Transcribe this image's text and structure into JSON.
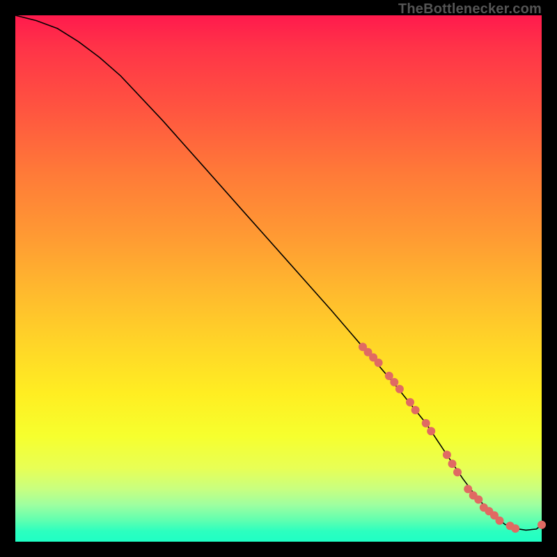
{
  "attribution": "TheBottlenecker.com",
  "chart_data": {
    "type": "line",
    "title": "",
    "xlabel": "",
    "ylabel": "",
    "xlim": [
      0,
      100
    ],
    "ylim": [
      0,
      100
    ],
    "series": [
      {
        "name": "curve",
        "x": [
          0,
          4,
          8,
          12,
          16,
          20,
          28,
          36,
          44,
          52,
          60,
          66,
          72,
          78,
          82,
          85,
          88,
          91,
          93,
          95,
          97,
          99,
          100
        ],
        "values": [
          100,
          99,
          97.5,
          95,
          92,
          88.5,
          80,
          71,
          62,
          53,
          44,
          37,
          30,
          22.5,
          16.5,
          12,
          8,
          5,
          3.3,
          2.5,
          2.2,
          2.4,
          3.2
        ]
      }
    ],
    "scatter": {
      "name": "highlighted-segment",
      "x": [
        66,
        67,
        68,
        69,
        71,
        72,
        73,
        75,
        76,
        78,
        79,
        82,
        83,
        84,
        86,
        87,
        88,
        89,
        90,
        91,
        92,
        94,
        95,
        100
      ],
      "y": [
        37,
        36,
        35,
        34,
        31.5,
        30.3,
        29,
        26.5,
        25,
        22.5,
        21,
        16.5,
        14.8,
        13.2,
        10,
        8.8,
        8,
        6.5,
        5.8,
        5,
        4,
        3,
        2.5,
        3.2
      ]
    }
  }
}
